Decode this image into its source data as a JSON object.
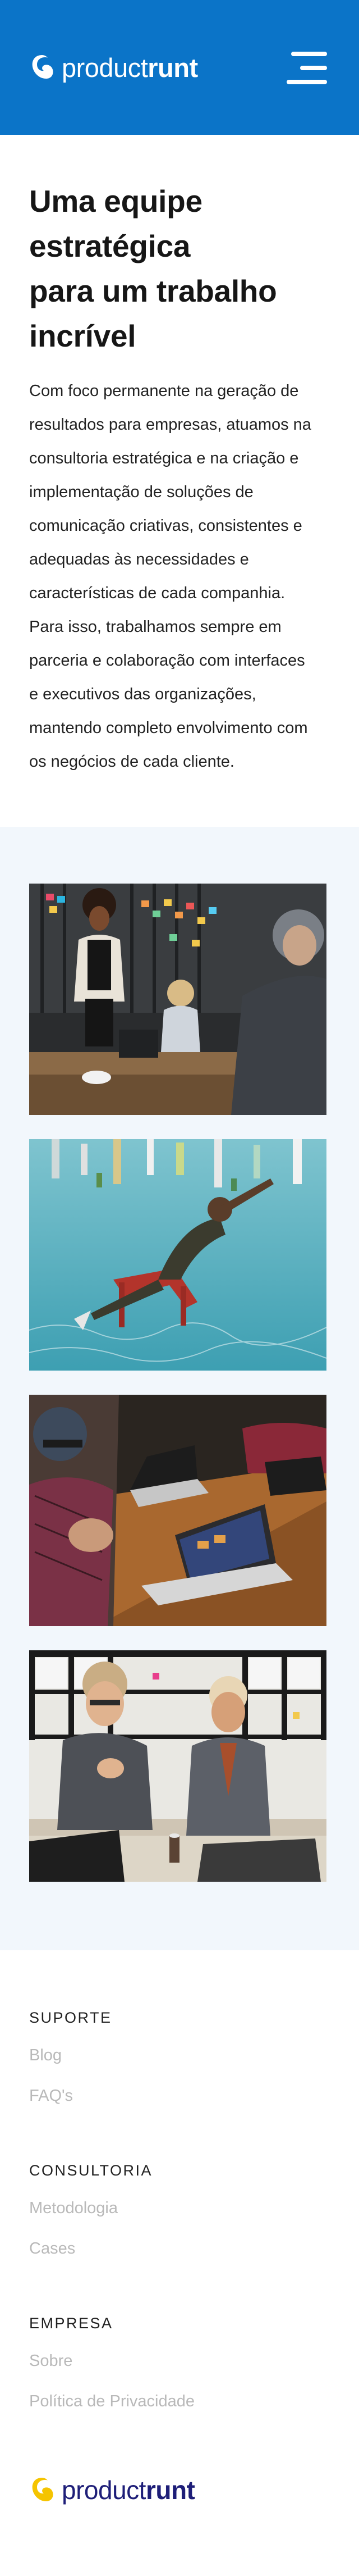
{
  "brand": {
    "name_light": "product",
    "name_bold": "runt",
    "header_color": "#0B74C8",
    "accent_yellow": "#F5C400",
    "footer_name_color": "#1E1E78",
    "logo_icon": "swirl-logo-icon"
  },
  "header": {
    "menu_icon": "hamburger-menu-icon"
  },
  "intro": {
    "title_lines": [
      "Uma equipe",
      "estratégica",
      "para um trabalho",
      "incrível"
    ],
    "paragraph_lines": [
      "Com foco permanente na geração de",
      "resultados para empresas, atuamos na",
      "consultoria estratégica e na criação e",
      "implementação de soluções de",
      "comunicação criativas, consistentes e",
      "adequadas às necessidades e",
      "características de cada companhia.",
      "Para isso, trabalhamos sempre em",
      "parceria e colaboração com interfaces",
      "e executivos das organizações,",
      "mantendo completo envolvimento com",
      "os negócios de cada cliente."
    ]
  },
  "gallery": {
    "background": "#F2F7FC",
    "photos": [
      "team-presentation-photo",
      "underwater-chair-photo",
      "laptop-meeting-photo",
      "office-conversation-photo"
    ]
  },
  "footer": {
    "groups": [
      {
        "heading": "SUPORTE",
        "links": [
          "Blog",
          "FAQ's"
        ]
      },
      {
        "heading": "CONSULTORIA",
        "links": [
          "Metodologia",
          "Cases"
        ]
      },
      {
        "heading": "EMPRESA",
        "links": [
          "Sobre",
          "Política de Privacidade"
        ]
      }
    ]
  }
}
